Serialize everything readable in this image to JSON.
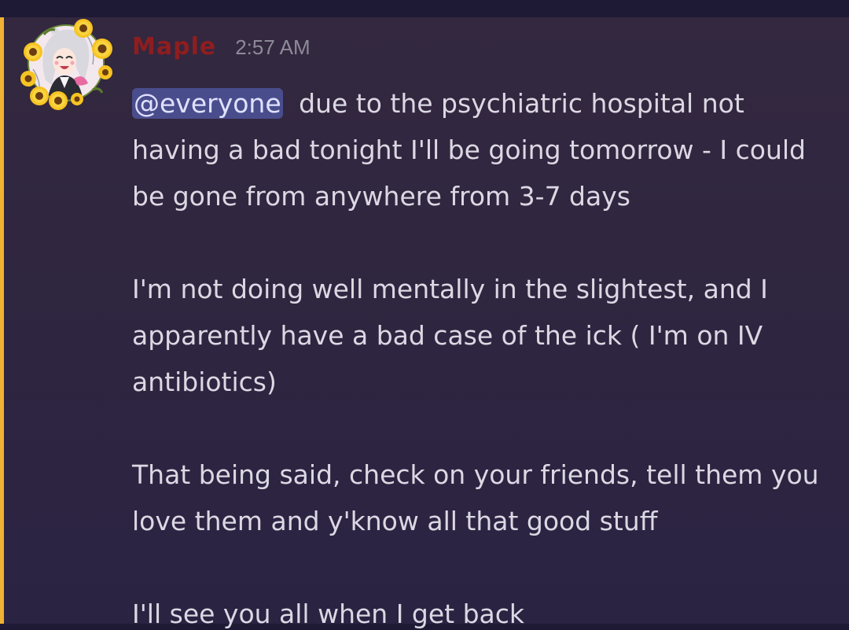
{
  "message": {
    "author": "Maple",
    "timestamp": "2:57 AM",
    "mention": "@everyone",
    "paragraphs": [
      " due to the psychiatric hospital not having a bad tonight I'll be going tomorrow - I could be gone from anywhere from 3-7 days",
      "I'm not doing well mentally in the slightest, and I apparently have a bad case of the ick ( I'm on IV antibiotics)",
      "That being said, check on your friends, tell them you love them and y'know all that good stuff",
      "I'll see you all when I get back"
    ],
    "avatar_icon": "anime-avatar-with-sunflower-frame-icon"
  },
  "colors": {
    "background": "#2f2640",
    "author_name": "#8f1d1f",
    "timestamp": "#8d8a99",
    "text": "#dcd8e3",
    "mention_bg": "#4a4d8c",
    "mention_bar": "#f0b232"
  }
}
